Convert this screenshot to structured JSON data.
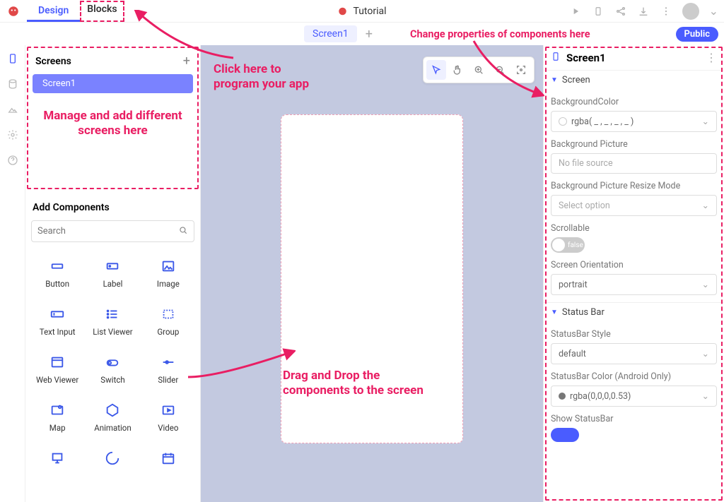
{
  "topbar": {
    "design_tab": "Design",
    "blocks_tab": "Blocks",
    "project_title": "Tutorial"
  },
  "secondbar": {
    "screen_chip": "Screen1",
    "public_pill": "Public"
  },
  "screens_panel": {
    "title": "Screens",
    "item1": "Screen1"
  },
  "add_components": {
    "title": "Add Components",
    "search_placeholder": "Search",
    "items": {
      "button": "Button",
      "label": "Label",
      "image": "Image",
      "text_input": "Text Input",
      "list_viewer": "List Viewer",
      "group": "Group",
      "web_viewer": "Web Viewer",
      "switch": "Switch",
      "slider": "Slider",
      "map": "Map",
      "animation": "Animation",
      "video": "Video"
    }
  },
  "properties": {
    "header": "Screen1",
    "section_screen": "Screen",
    "bg_color_label": "BackgroundColor",
    "bg_color_value": "rgba( _ , _ , _ , _ )",
    "bg_picture_label": "Background Picture",
    "bg_picture_value": "No file source",
    "bg_resize_label": "Background Picture Resize Mode",
    "bg_resize_value": "Select option",
    "scrollable_label": "Scrollable",
    "scrollable_value": "false",
    "orientation_label": "Screen Orientation",
    "orientation_value": "portrait",
    "section_statusbar": "Status Bar",
    "statusbar_style_label": "StatusBar Style",
    "statusbar_style_value": "default",
    "statusbar_color_label": "StatusBar Color (Android Only)",
    "statusbar_color_value": "rgba(0,0,0,0.53)",
    "show_statusbar_label": "Show StatusBar"
  },
  "annotations": {
    "click_blocks": "Click here to program your app",
    "manage_screens": "Manage and add different screens here",
    "drag_drop": "Drag and Drop the components to the screen",
    "change_props": "Change properties of components here"
  }
}
